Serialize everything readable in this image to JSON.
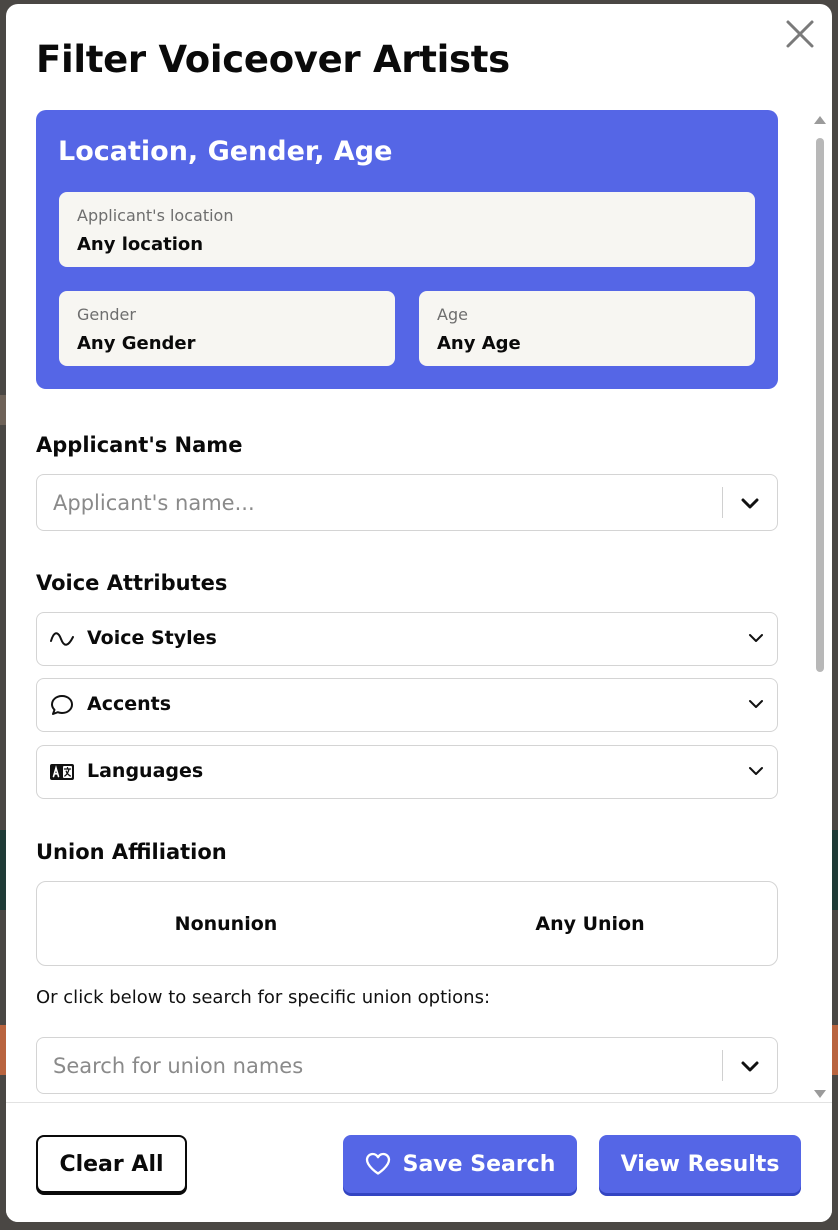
{
  "modal": {
    "title": "Filter Voiceover Artists"
  },
  "location_card": {
    "heading": "Location, Gender, Age",
    "location": {
      "label": "Applicant's location",
      "value": "Any location"
    },
    "gender": {
      "label": "Gender",
      "value": "Any Gender"
    },
    "age": {
      "label": "Age",
      "value": "Any Age"
    }
  },
  "applicant_name": {
    "label": "Applicant's Name",
    "placeholder": "Applicant's name..."
  },
  "voice_attributes": {
    "label": "Voice Attributes",
    "items": [
      {
        "label": "Voice Styles",
        "icon": "wave-icon"
      },
      {
        "label": "Accents",
        "icon": "speech-bubble-icon"
      },
      {
        "label": "Languages",
        "icon": "translate-icon"
      }
    ]
  },
  "union": {
    "label": "Union Affiliation",
    "options": [
      "Nonunion",
      "Any Union"
    ],
    "helper": "Or click below to search for specific union options:",
    "search_placeholder": "Search for union names"
  },
  "footer": {
    "clear_label": "Clear All",
    "save_label": "Save Search",
    "view_label": "View Results"
  },
  "colors": {
    "accent": "#5566e6",
    "field_bg": "#f7f6f2",
    "text": "#0a0a0a"
  }
}
